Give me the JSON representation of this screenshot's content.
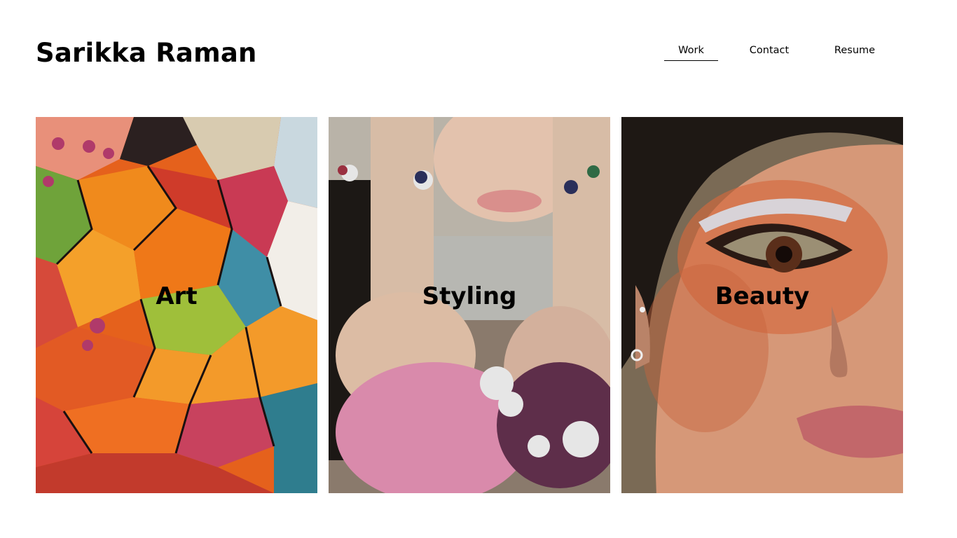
{
  "header": {
    "site_title": "Sarikka Raman"
  },
  "nav": {
    "items": [
      {
        "label": "Work",
        "active": true
      },
      {
        "label": "Contact",
        "active": false
      },
      {
        "label": "Resume",
        "active": false
      }
    ]
  },
  "gallery": {
    "cards": [
      {
        "label": "Art"
      },
      {
        "label": "Styling"
      },
      {
        "label": "Beauty"
      }
    ]
  }
}
